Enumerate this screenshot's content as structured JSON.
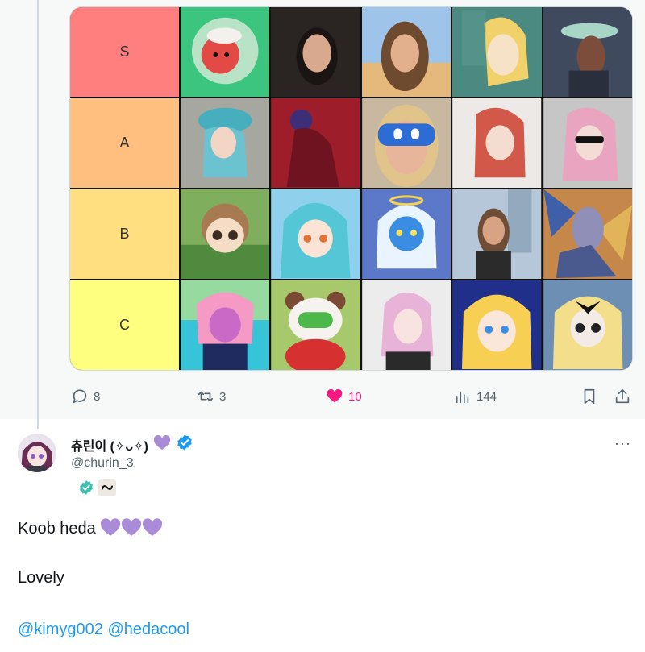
{
  "tier_list": {
    "tiers": [
      {
        "label": "S",
        "color": "#ff7f7f"
      },
      {
        "label": "A",
        "color": "#ffbf7f"
      },
      {
        "label": "B",
        "color": "#ffdf7f"
      },
      {
        "label": "C",
        "color": "#ffff7f"
      }
    ]
  },
  "previous_tweet_actions": {
    "reply_count": "8",
    "retweet_count": "3",
    "like_count": "10",
    "views_count": "144",
    "like_color": "#f91880"
  },
  "tweet": {
    "author_name": "츄린이 (✧ᴗ✧)",
    "author_emoji": "purple-heart-icon",
    "verified_color": "#1d9bf0",
    "handle": "@churin_3",
    "more_label": "···",
    "line1": "Koob heda",
    "line2": "Lovely",
    "mention1": "@kimyg002",
    "mention2": "@hedacool",
    "heart_color": "#a98bd8",
    "mention_color": "#1d9bf0"
  }
}
